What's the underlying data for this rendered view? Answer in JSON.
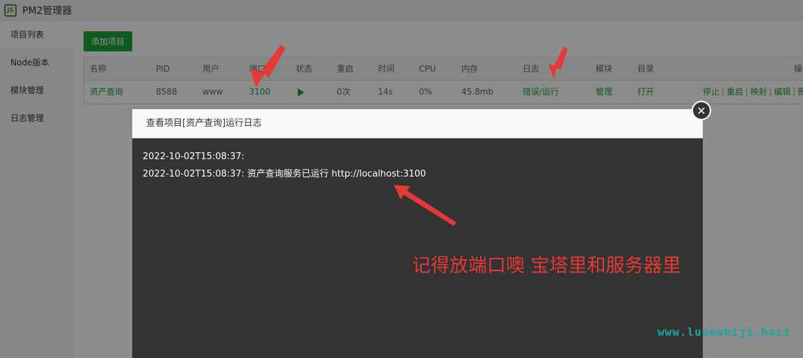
{
  "window": {
    "title": "PM2管理器",
    "logo_text": "JS"
  },
  "sidebar": {
    "items": [
      {
        "label": "项目列表",
        "active": true
      },
      {
        "label": "Node版本",
        "active": false
      },
      {
        "label": "模块管理",
        "active": false
      },
      {
        "label": "日志管理",
        "active": false
      }
    ]
  },
  "toolbar": {
    "add_label": "添加项目"
  },
  "table": {
    "headers": {
      "name": "名称",
      "pid": "PID",
      "user": "用户",
      "port": "端口",
      "status": "状态",
      "restart": "重启",
      "time": "时间",
      "cpu": "CPU",
      "mem": "内存",
      "log": "日志",
      "module": "模块",
      "dir": "目录",
      "ops": "操"
    },
    "row": {
      "name": "资产查询",
      "pid": "8588",
      "user": "www",
      "port": "3100",
      "status_icon": "play-icon",
      "restart": "0次",
      "time": "14s",
      "cpu": "0%",
      "mem": "45.8mb",
      "log": "错误/运行",
      "module": "管理",
      "dir": "打开",
      "ops": [
        "停止",
        "重启",
        "映射",
        "编辑",
        "删"
      ]
    }
  },
  "dialog": {
    "title": "查看项目[资产查询]运行日志",
    "lines": [
      "2022-10-02T15:08:37:",
      "2022-10-02T15:08:37: 资产查询服务已运行 http://localhost:3100"
    ],
    "close_icon": "close-icon"
  },
  "annotation": {
    "note": "记得放端口噢 宝塔里和服务器里",
    "color": "#e53935"
  },
  "watermark": "www.luomubiji.host",
  "colors": {
    "accent": "#20a53a",
    "log_bg": "#333333"
  }
}
